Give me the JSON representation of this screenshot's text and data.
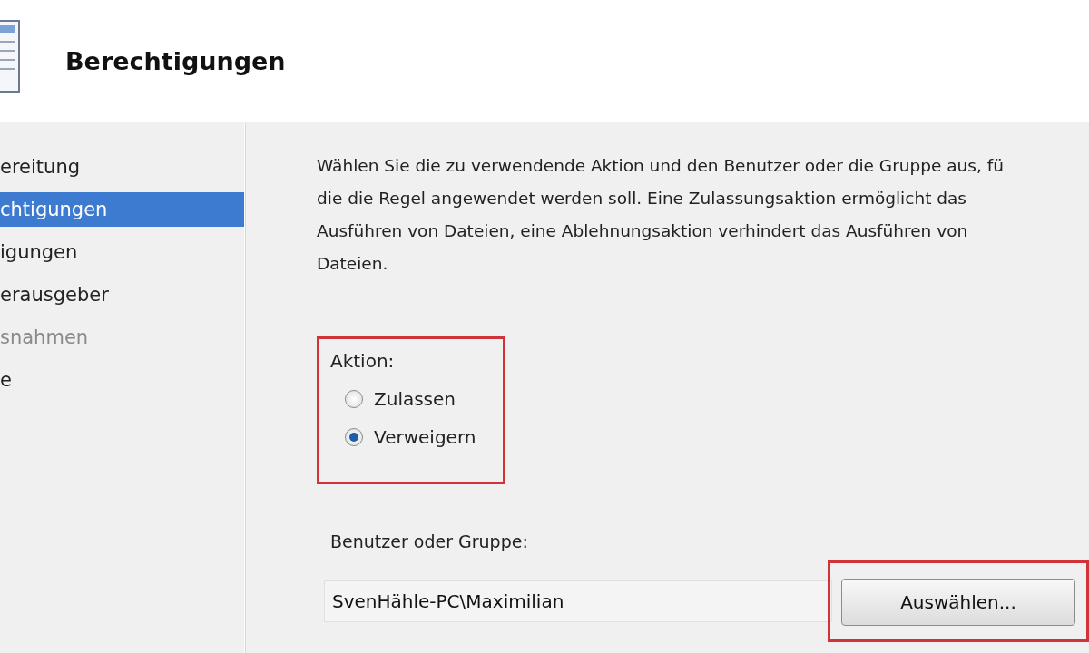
{
  "header": {
    "title": "Berechtigungen"
  },
  "sidebar": {
    "items": [
      {
        "label": "ereitung",
        "selected": false,
        "disabled": false
      },
      {
        "label": "chtigungen",
        "selected": true,
        "disabled": false
      },
      {
        "label": "igungen",
        "selected": false,
        "disabled": false
      },
      {
        "label": "erausgeber",
        "selected": false,
        "disabled": false
      },
      {
        "label": "snahmen",
        "selected": false,
        "disabled": true
      },
      {
        "label": "e",
        "selected": false,
        "disabled": false
      }
    ]
  },
  "description": "Wählen Sie die zu verwendende Aktion und den Benutzer oder die Gruppe aus, fü\ndie die Regel angewendet werden soll. Eine Zulassungsaktion ermöglicht das\nAusführen von Dateien, eine Ablehnungsaktion verhindert das Ausführen von\nDateien.",
  "action": {
    "label": "Aktion:",
    "highlighted": true,
    "options": [
      {
        "label": "Zulassen",
        "selected": false
      },
      {
        "label": "Verweigern",
        "selected": true
      }
    ]
  },
  "user": {
    "label": "Benutzer oder Gruppe:",
    "value": "SvenHähle-PC\\Maximilian",
    "button": {
      "label": "Auswählen...",
      "highlighted": true
    }
  }
}
